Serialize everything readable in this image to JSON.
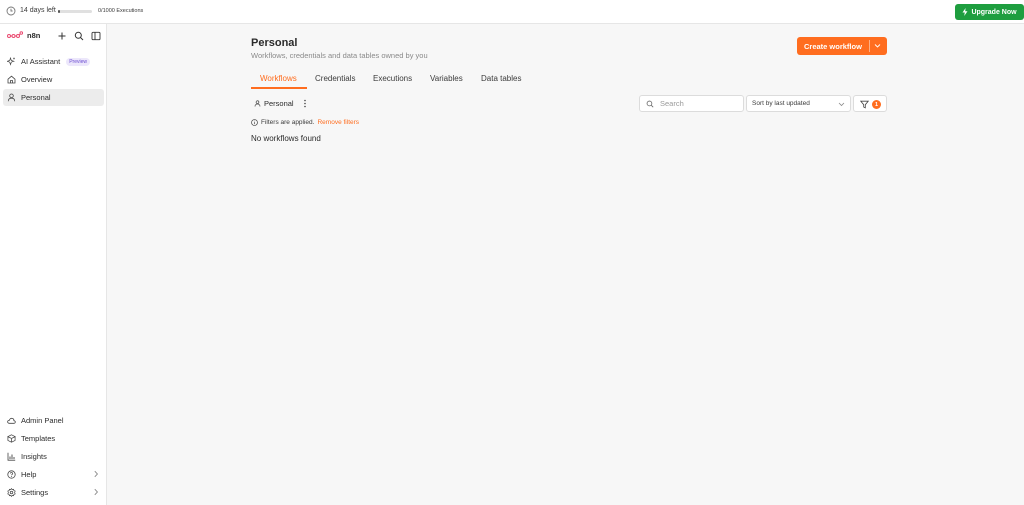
{
  "topbar": {
    "trial_days": "14 days left",
    "executions": "0/1000 Executions",
    "executions_used_fraction": 0.0,
    "upgrade_label": "Upgrade Now",
    "upgrade_color": "#1e9e3f"
  },
  "sidebar": {
    "brand": "n8n",
    "items": [
      {
        "label": "AI Assistant",
        "badge": "Preview",
        "icon": "sparkle-icon"
      },
      {
        "label": "Overview",
        "icon": "home-icon"
      },
      {
        "label": "Personal",
        "icon": "user-icon",
        "active": true
      }
    ],
    "bottom_items": [
      {
        "label": "Admin Panel",
        "icon": "cloud-icon"
      },
      {
        "label": "Templates",
        "icon": "box-icon"
      },
      {
        "label": "Insights",
        "icon": "bar-chart-icon"
      },
      {
        "label": "Help",
        "icon": "help-icon"
      },
      {
        "label": "Settings",
        "icon": "gear-icon"
      }
    ]
  },
  "main": {
    "title": "Personal",
    "subtitle": "Workflows, credentials and data tables owned by you",
    "create_label": "Create workflow",
    "accent_color": "#ff6d1f",
    "tabs": [
      "Workflows",
      "Credentials",
      "Executions",
      "Variables",
      "Data tables"
    ],
    "active_tab": "Workflows",
    "project": "Personal",
    "search_placeholder": "Search",
    "sort_value": "Sort by last updated",
    "filter_count": "1",
    "filters_note": "Filters are applied.",
    "remove_filters": "Remove filters",
    "empty_message": "No workflows found"
  }
}
